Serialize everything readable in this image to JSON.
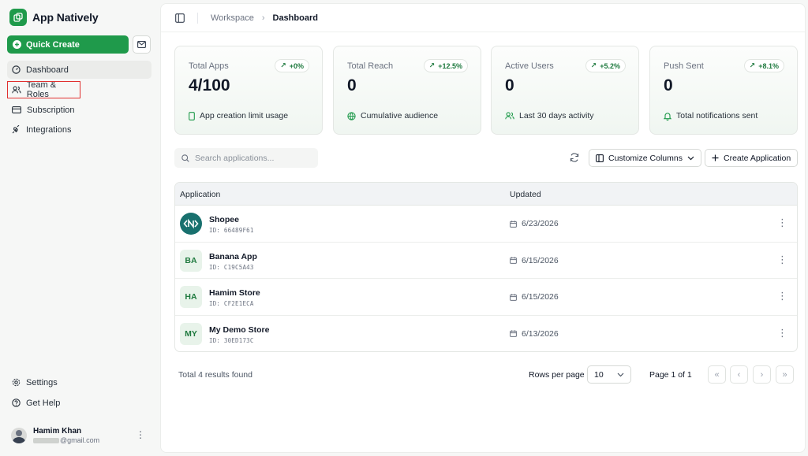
{
  "brand": {
    "name": "App Natively"
  },
  "sidebar": {
    "quick_create": "Quick Create",
    "items": [
      {
        "label": "Dashboard",
        "icon": "gauge-icon"
      },
      {
        "label": "Team & Roles",
        "icon": "users-icon"
      },
      {
        "label": "Subscription",
        "icon": "credit-card-icon"
      },
      {
        "label": "Integrations",
        "icon": "plug-icon"
      }
    ],
    "bottom_items": [
      {
        "label": "Settings",
        "icon": "gear-icon"
      },
      {
        "label": "Get Help",
        "icon": "help-circle-icon"
      }
    ],
    "user": {
      "name": "Hamim Khan",
      "email": "@gmail.com"
    }
  },
  "breadcrumb": {
    "parent": "Workspace",
    "current": "Dashboard"
  },
  "stats": [
    {
      "label": "Total Apps",
      "badge": "+0%",
      "value": "4/100",
      "footer": "App creation limit usage",
      "icon": "phone-icon"
    },
    {
      "label": "Total Reach",
      "badge": "+12.5%",
      "value": "0",
      "footer": "Cumulative audience",
      "icon": "globe-icon"
    },
    {
      "label": "Active Users",
      "badge": "+5.2%",
      "value": "0",
      "footer": "Last 30 days activity",
      "icon": "users-icon"
    },
    {
      "label": "Push Sent",
      "badge": "+8.1%",
      "value": "0",
      "footer": "Total notifications sent",
      "icon": "bell-icon"
    }
  ],
  "toolbar": {
    "search_placeholder": "Search applications...",
    "customize_columns": "Customize Columns",
    "create_application": "Create Application"
  },
  "table": {
    "headers": {
      "application": "Application",
      "updated": "Updated"
    },
    "rows": [
      {
        "name": "Shopee",
        "id": "ID: 66489F61",
        "initials": "",
        "date": "6/23/2026"
      },
      {
        "name": "Banana App",
        "id": "ID: C19C5A43",
        "initials": "BA",
        "date": "6/15/2026"
      },
      {
        "name": "Hamim Store",
        "id": "ID: CF2E1ECA",
        "initials": "HA",
        "date": "6/15/2026"
      },
      {
        "name": "My Demo Store",
        "id": "ID: 30ED173C",
        "initials": "MY",
        "date": "6/13/2026"
      }
    ]
  },
  "pagination": {
    "total": "Total 4 results found",
    "rows_per_page_label": "Rows per page",
    "rows_per_page": "10",
    "page_info": "Page 1 of 1"
  },
  "colors": {
    "brand": "#1f9a4b",
    "highlight": "#e0302f"
  }
}
